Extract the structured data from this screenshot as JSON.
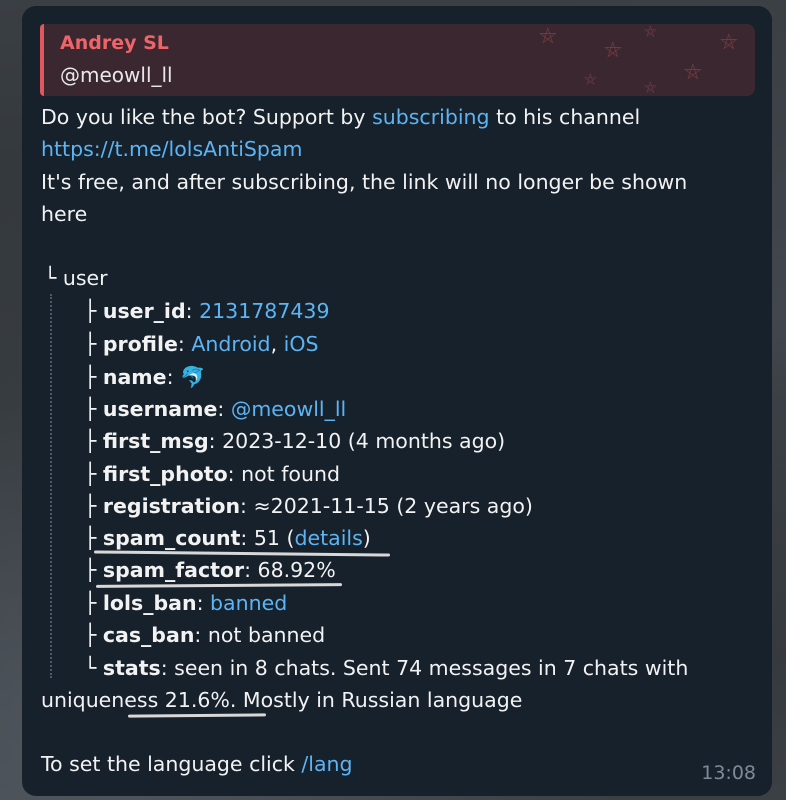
{
  "reply": {
    "name": "Andrey SL",
    "username": "@meowll_ll"
  },
  "intro": {
    "line1_prefix": "Do you like the bot? Support by ",
    "line1_link": "subscribing",
    "line1_suffix": " to his channel",
    "channel_url": "https://t.me/lolsAntiSpam",
    "line3": "It's free, and after subscribing, the link will no longer be shown",
    "line4": "here"
  },
  "tree": {
    "root": "user",
    "user_id_key": "user_id",
    "user_id_val": "2131787439",
    "profile_key": "profile",
    "profile_val1": "Android",
    "profile_val2": "iOS",
    "name_key": "name",
    "name_val": "🐬",
    "username_key": "username",
    "username_val": "@meowll_ll",
    "first_msg_key": "first_msg",
    "first_msg_val": "2023-12-10 (4 months ago)",
    "first_photo_key": "first_photo",
    "first_photo_val": "not found",
    "registration_key": "registration",
    "registration_val": "≈2021-11-15 (2 years ago)",
    "spam_count_key": "spam_count",
    "spam_count_val": "51",
    "spam_count_link": "details",
    "spam_factor_key": "spam_factor",
    "spam_factor_val": "68.92%",
    "lols_ban_key": "lols_ban",
    "lols_ban_val": "banned",
    "cas_ban_key": "cas_ban",
    "cas_ban_val": "not banned",
    "stats_key": "stats",
    "stats_val": "seen in 8 chats. Sent 74 messages in 7 chats with",
    "stats_cont": "uniqueness 21.6%. Mostly in Russian language"
  },
  "footer": {
    "lang_prefix": "To set the language click ",
    "lang_cmd": "/lang",
    "time": "13:08"
  },
  "colors": {
    "bubble": "#17212b",
    "link": "#5db4f3",
    "reply_accent": "#e1565f",
    "reply_name": "#ef6468"
  }
}
